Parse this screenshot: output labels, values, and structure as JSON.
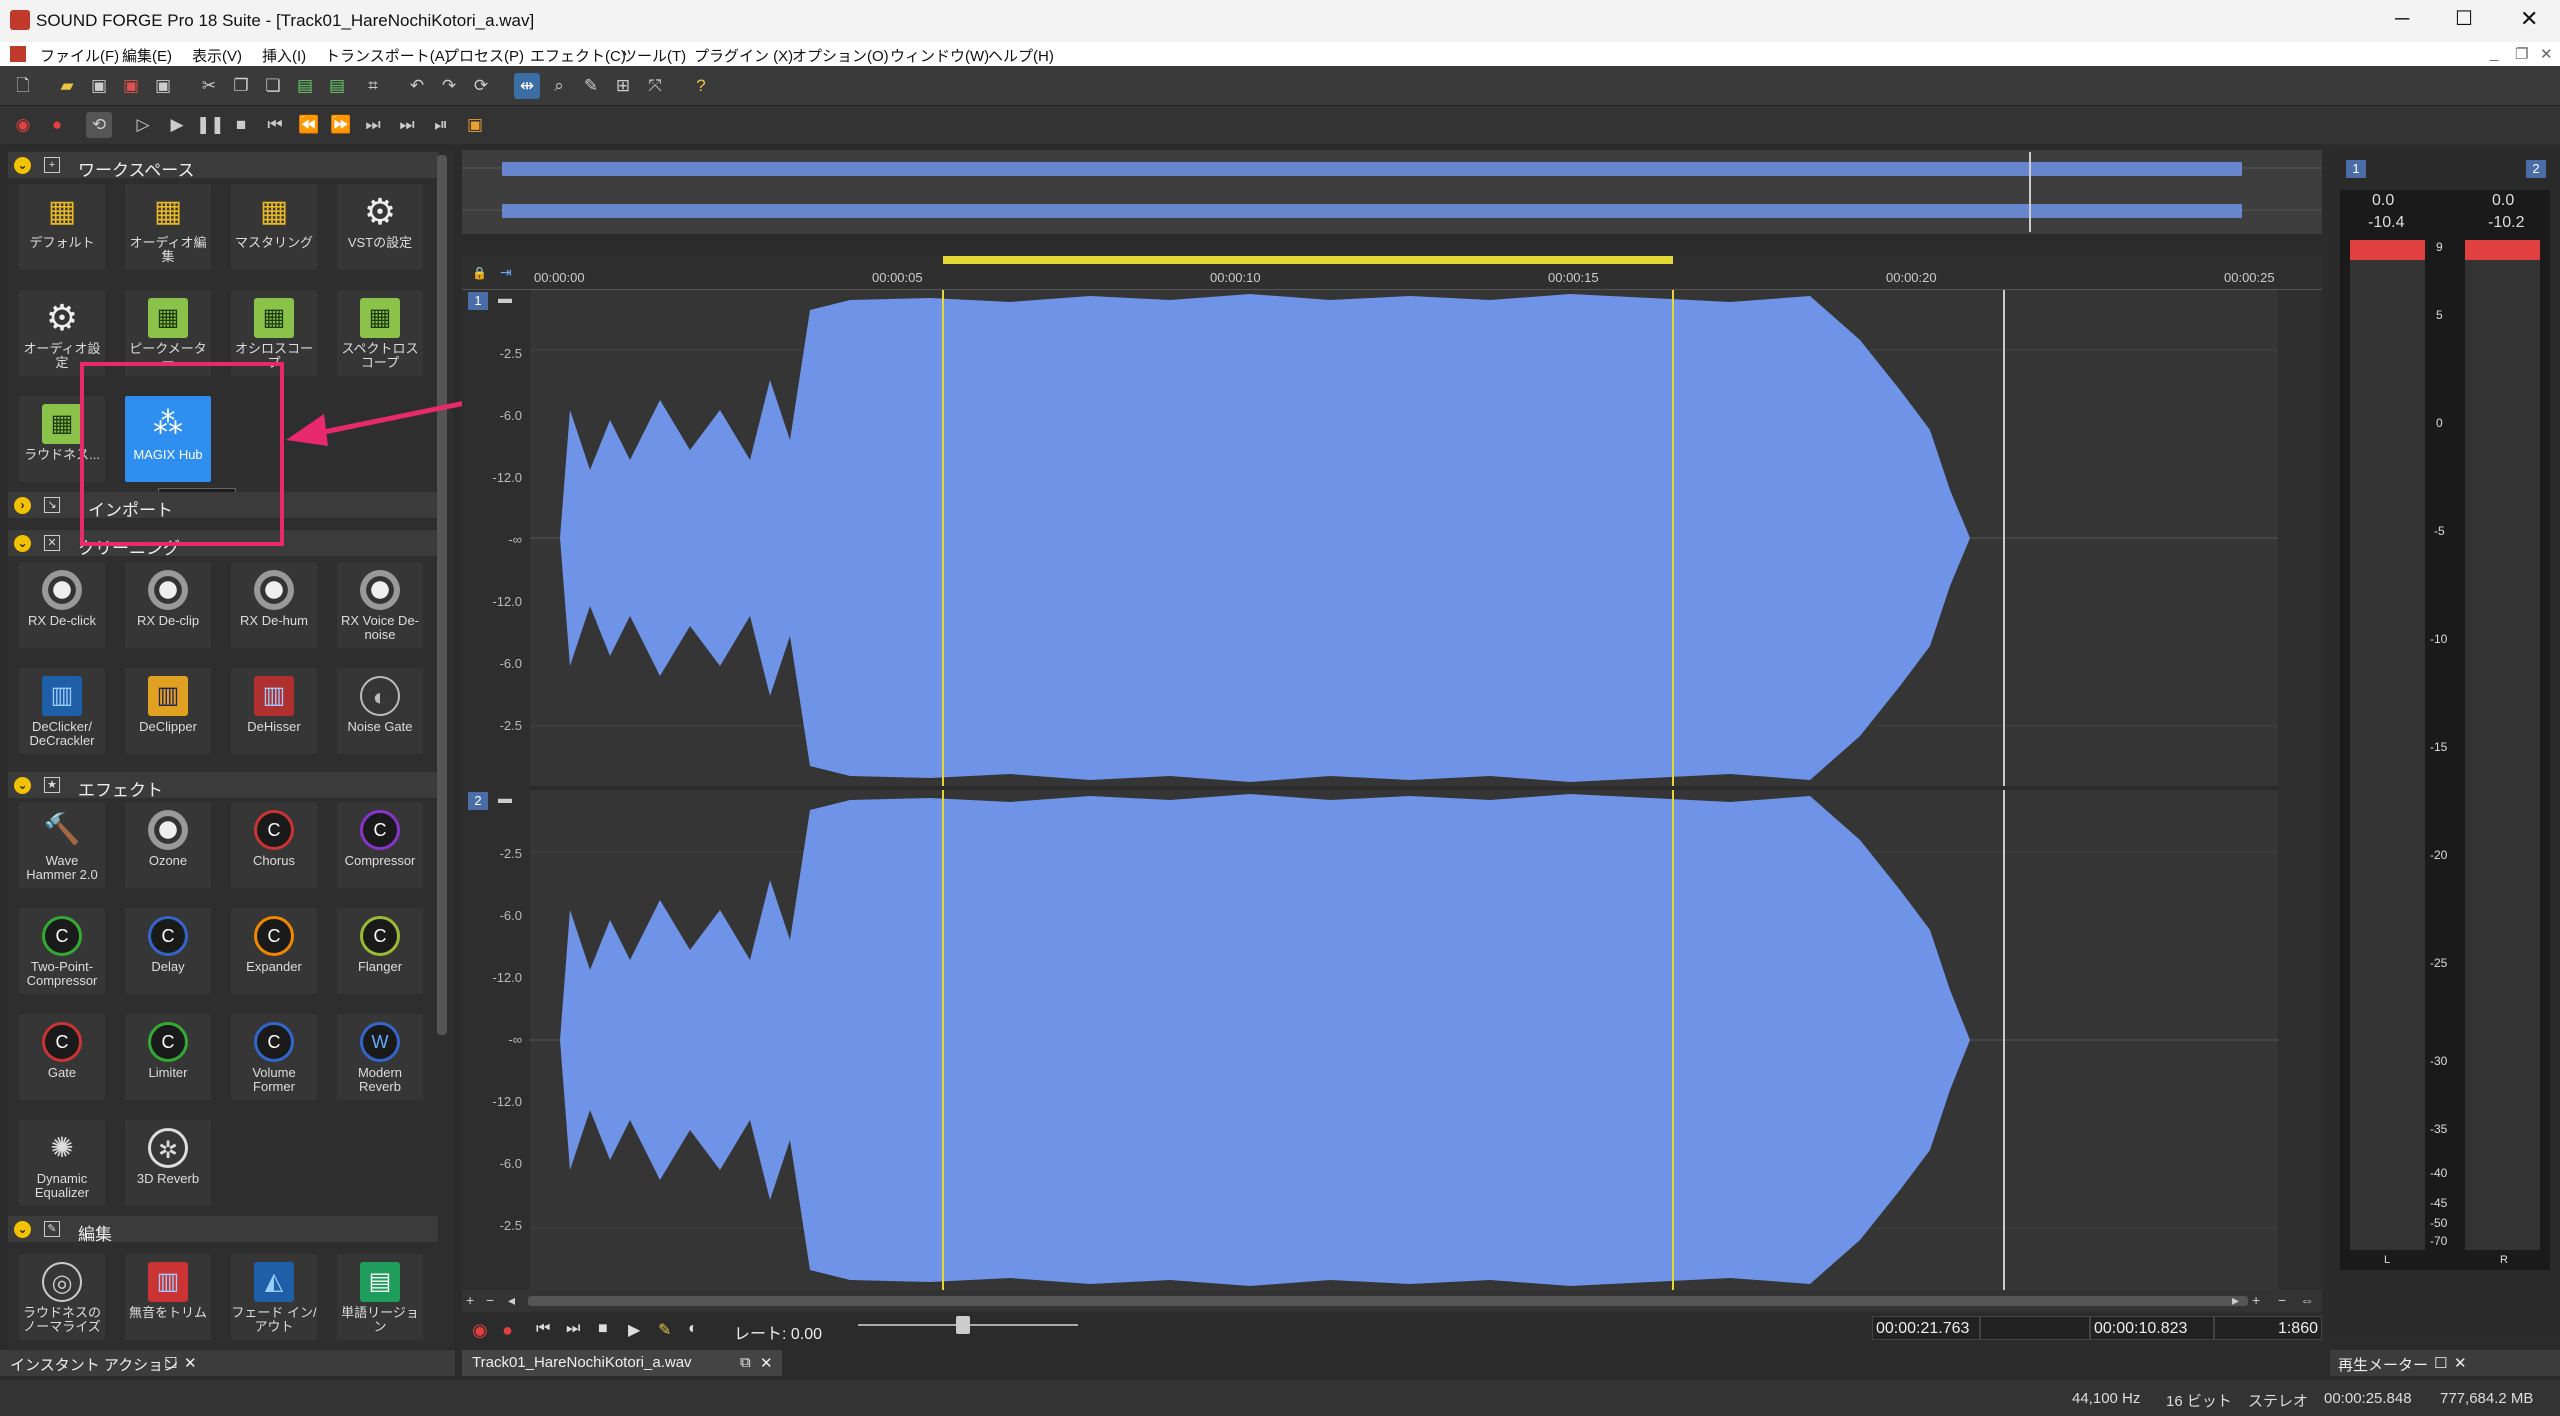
{
  "app": {
    "title": "SOUND FORGE Pro 18 Suite - [Track01_HareNochiKotori_a.wav]"
  },
  "menu": [
    "ファイル(F)",
    "編集(E)",
    "表示(V)",
    "挿入(I)",
    "トランスポート(A)",
    "プロセス(P)",
    "エフェクト(C)",
    "ツール(T)",
    "プラグイン (X)",
    "オプション(O)",
    "ウィンドウ(W)",
    "ヘルプ(H)"
  ],
  "workspace": {
    "title": "ワークスペース",
    "tiles": [
      "デフォルト",
      "オーディオ編集",
      "マスタリング",
      "VSTの設定",
      "オーディオ設定",
      "ピークメーター",
      "オシロスコープ",
      "スペクトロスコープ",
      "ラウドネス...",
      "MAGIX Hub"
    ],
    "tooltip": "MAGIX Hub"
  },
  "import": {
    "title": "インポート"
  },
  "cleaning": {
    "title": "クリーニング",
    "tiles": [
      "RX De-click",
      "RX De-clip",
      "RX De-hum",
      "RX Voice De-noise",
      "DeClicker/ DeCrackler",
      "DeClipper",
      "DeHisser",
      "Noise Gate"
    ]
  },
  "effects": {
    "title": "エフェクト",
    "tiles": [
      "Wave Hammer 2.0",
      "Ozone",
      "Chorus",
      "Compressor",
      "Two-Point-Compressor",
      "Delay",
      "Expander",
      "Flanger",
      "Gate",
      "Limiter",
      "Volume Former",
      "Modern Reverb",
      "Dynamic Equalizer",
      "3D Reverb"
    ]
  },
  "edit": {
    "title": "編集",
    "tiles": [
      "ラウドネスのノーマライズ",
      "無音をトリム",
      "フェード イン/アウト",
      "単語リージョン"
    ]
  },
  "ruler": {
    "ticks": [
      "00:00:00",
      "00:00:05",
      "00:00:10",
      "00:00:15",
      "00:00:20",
      "00:00:25"
    ]
  },
  "channels": {
    "ch1": "1",
    "ch2": "2",
    "db": [
      "-2.5",
      "-6.0",
      "-12.0",
      "-∞",
      "-12.0",
      "-6.0",
      "-2.5"
    ]
  },
  "transport": {
    "rate": "レート: 0.00",
    "pos": "00:00:21.763",
    "len": "00:00:10.823",
    "zoom": "1:860"
  },
  "tabs": {
    "instant": "インスタント アクション",
    "doc": "Track01_HareNochiKotori_a.wav",
    "meter": "再生メーター"
  },
  "meter": {
    "ch1": "1",
    "ch2": "2",
    "peakL": "0.0",
    "peakR": "0.0",
    "rmsL": "-10.4",
    "rmsR": "-10.2",
    "scale": [
      "9",
      "5",
      "0",
      "-5",
      "-10",
      "-15",
      "-20",
      "-25",
      "-30",
      "-35",
      "-40",
      "-45",
      "-50",
      "-70"
    ],
    "l": "L",
    "r": "R"
  },
  "status": {
    "rate": "44,100 Hz",
    "bits": "16 ビット",
    "mode": "ステレオ",
    "dur": "00:00:25.848",
    "mem": "777,684.2 MB"
  },
  "colors": {
    "wave": "#6f93e6",
    "select": "#e3d834",
    "highlight": "#e8296c",
    "accent": "#2f8ff0"
  }
}
